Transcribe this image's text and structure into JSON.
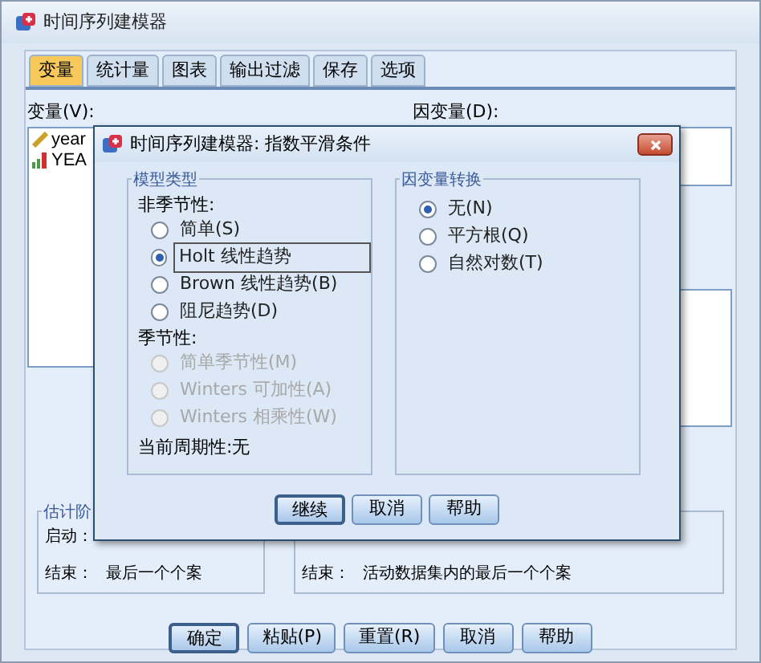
{
  "window": {
    "title": "时间序列建模器"
  },
  "tabs": [
    {
      "label": "变量",
      "selected": true
    },
    {
      "label": "统计量",
      "selected": false
    },
    {
      "label": "图表",
      "selected": false
    },
    {
      "label": "输出过滤",
      "selected": false
    },
    {
      "label": "保存",
      "selected": false
    },
    {
      "label": "选项",
      "selected": false
    }
  ],
  "variables": {
    "label": "变量(V):",
    "items": [
      {
        "name": "year",
        "kind": "ruler"
      },
      {
        "name": "YEA",
        "kind": "bars"
      }
    ]
  },
  "dependent": {
    "label": "因变量(D):"
  },
  "estimation_group": {
    "title": "估计阶",
    "start_label": "启动：",
    "end_label": "结束：",
    "end_value": "最后一个个案"
  },
  "forecast_group": {
    "end_label": "结束：",
    "end_value": "活动数据集内的最后一个个案"
  },
  "buttons": [
    {
      "label": "确定",
      "default": true
    },
    {
      "label": "粘贴(P)",
      "default": false
    },
    {
      "label": "重置(R)",
      "default": false
    },
    {
      "label": "取消",
      "default": false
    },
    {
      "label": "帮助",
      "default": false
    }
  ],
  "dialog": {
    "title": "时间序列建模器: 指数平滑条件",
    "model_type": {
      "title": "模型类型",
      "nonseasonal_label": "非季节性:",
      "nonseasonal": [
        {
          "label": "简单(S)",
          "selected": false,
          "disabled": false,
          "focused": false
        },
        {
          "label": "Holt 线性趋势",
          "selected": true,
          "disabled": false,
          "focused": true
        },
        {
          "label": "Brown 线性趋势(B)",
          "selected": false,
          "disabled": false,
          "focused": false
        },
        {
          "label": "阻尼趋势(D)",
          "selected": false,
          "disabled": false,
          "focused": false
        }
      ],
      "seasonal_label": "季节性:",
      "seasonal": [
        {
          "label": "简单季节性(M)",
          "selected": false,
          "disabled": true,
          "focused": false
        },
        {
          "label": "Winters 可加性(A)",
          "selected": false,
          "disabled": true,
          "focused": false
        },
        {
          "label": "Winters 相乘性(W)",
          "selected": false,
          "disabled": true,
          "focused": false
        }
      ],
      "periodicity": "当前周期性:无"
    },
    "transform": {
      "title": "因变量转换",
      "options": [
        {
          "label": "无(N)",
          "selected": true,
          "disabled": false,
          "focused": false
        },
        {
          "label": "平方根(Q)",
          "selected": false,
          "disabled": false,
          "focused": false
        },
        {
          "label": "自然对数(T)",
          "selected": false,
          "disabled": false,
          "focused": false
        }
      ]
    },
    "buttons": [
      {
        "label": "继续",
        "default": true
      },
      {
        "label": "取消",
        "default": false
      },
      {
        "label": "帮助",
        "default": false
      }
    ]
  }
}
